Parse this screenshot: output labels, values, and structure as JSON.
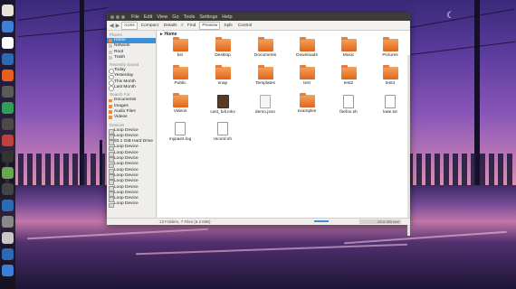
{
  "window": {
    "menu": [
      "File",
      "Edit",
      "View",
      "Go",
      "Tools",
      "Settings",
      "Help"
    ],
    "toolbar": {
      "icons_view": "Icons",
      "compact_view": "Compact",
      "details_view": "Details",
      "find": "Find",
      "preview": "Preview",
      "split": "Split",
      "control": "Control"
    },
    "path": "Home"
  },
  "sidebar": {
    "places_title": "Places",
    "places": [
      "Home",
      "Network",
      "Root",
      "Trash"
    ],
    "recent_title": "Recently Saved",
    "recent": [
      "Today",
      "Yesterday",
      "This Month",
      "Last Month"
    ],
    "search_title": "Search For",
    "search": [
      "Documents",
      "Images",
      "Audio Files",
      "Videos"
    ],
    "devices_title": "Devices",
    "devices": [
      "Loop Device",
      "Loop Device",
      "93.1 GiB Hard Drive",
      "Loop Device",
      "Loop Device",
      "Loop Device",
      "Loop Device",
      "Loop Device",
      "Loop Device",
      "Loop Device",
      "Loop Device",
      "Loop Device",
      "Loop Device",
      "Loop Device"
    ]
  },
  "files": [
    {
      "name": "bin",
      "type": "folder"
    },
    {
      "name": "Desktop",
      "type": "folder"
    },
    {
      "name": "Documents",
      "type": "folder"
    },
    {
      "name": "Downloads",
      "type": "folder"
    },
    {
      "name": "Music",
      "type": "folder"
    },
    {
      "name": "Pictures",
      "type": "folder"
    },
    {
      "name": "Public",
      "type": "folder"
    },
    {
      "name": "snap",
      "type": "folder"
    },
    {
      "name": "Templates",
      "type": "folder"
    },
    {
      "name": "test",
      "type": "folder"
    },
    {
      "name": "test2",
      "type": "folder"
    },
    {
      "name": "test4",
      "type": "folder"
    },
    {
      "name": "Videos",
      "type": "folder"
    },
    {
      "name": "cast_full.mkv",
      "type": "video"
    },
    {
      "name": "demo.json",
      "type": "file"
    },
    {
      "name": "examples",
      "type": "folder"
    },
    {
      "name": "firefox.sh",
      "type": "txt"
    },
    {
      "name": "kate.txt",
      "type": "txt"
    },
    {
      "name": "mypaint.log",
      "type": "txt"
    },
    {
      "name": "record.sh",
      "type": "txt"
    }
  ],
  "status": {
    "summary": "13 Folders, 7 Files (6.3 MiB)",
    "free": "83.8 GiB free"
  }
}
